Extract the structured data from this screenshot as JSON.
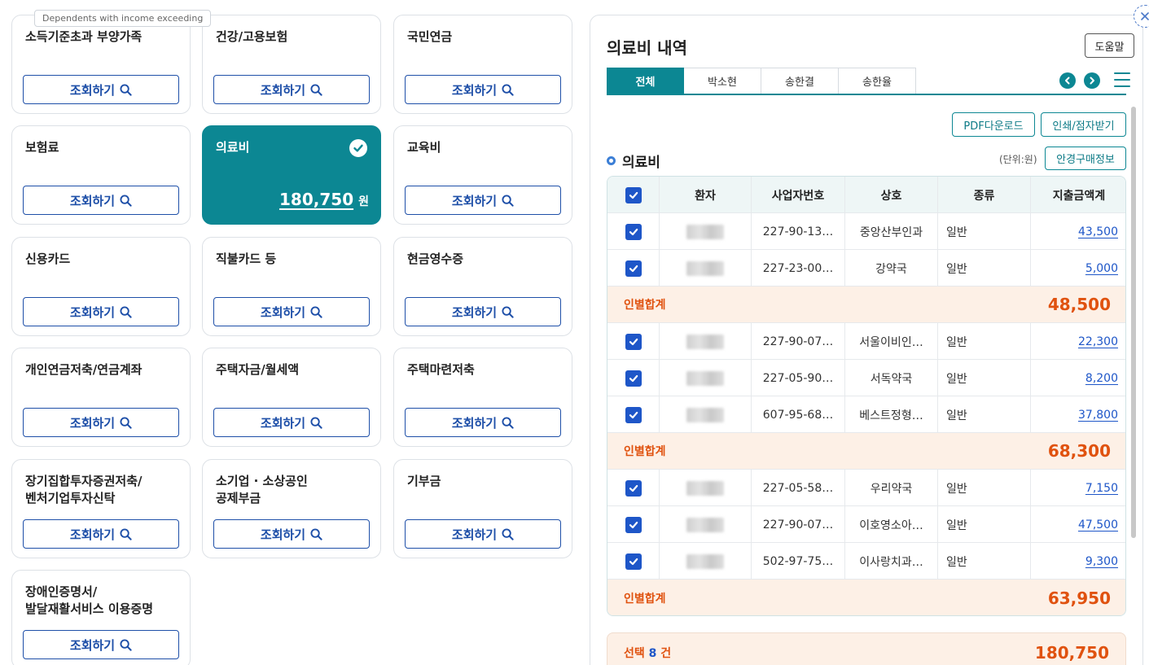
{
  "tooltip": "Dependents with income exceeding",
  "cards": [
    {
      "title": "소득기준초과 부양가족",
      "button": "조회하기"
    },
    {
      "title": "건강/고용보험",
      "button": "조회하기"
    },
    {
      "title": "국민연금",
      "button": "조회하기"
    },
    {
      "title": "보험료",
      "button": "조회하기"
    },
    {
      "title": "의료비",
      "amount": "180,750",
      "unit": "원"
    },
    {
      "title": "교육비",
      "button": "조회하기"
    },
    {
      "title": "신용카드",
      "button": "조회하기"
    },
    {
      "title": "직불카드 등",
      "button": "조회하기"
    },
    {
      "title": "현금영수증",
      "button": "조회하기"
    },
    {
      "title": "개인연금저축/연금계좌",
      "button": "조회하기"
    },
    {
      "title": "주택자금/월세액",
      "button": "조회하기"
    },
    {
      "title": "주택마련저축",
      "button": "조회하기"
    },
    {
      "title_line1": "장기집합투자증권저축/",
      "title_line2": "벤처기업투자신탁",
      "button": "조회하기"
    },
    {
      "title_line1": "소기업 · 소상공인",
      "title_line2": "공제부금",
      "button": "조회하기"
    },
    {
      "title": "기부금",
      "button": "조회하기"
    },
    {
      "title_line1": "장애인증명서/",
      "title_line2": "발달재활서비스 이용증명",
      "button": "조회하기"
    }
  ],
  "panel": {
    "title": "의료비 내역",
    "help": "도움말",
    "tabs": [
      "전체",
      "박소현",
      "송한결",
      "송한율"
    ],
    "pdf_download": "PDF다운로드",
    "print_braille": "인쇄/점자받기",
    "section_title": "의료비",
    "unit": "(단위:원)",
    "glasses_info": "안경구매정보",
    "columns": [
      "환자",
      "사업자번호",
      "상호",
      "종류",
      "지출금액계"
    ],
    "rows": [
      {
        "biz": "227-90-13…",
        "name": "중앙산부인과",
        "kind": "일반",
        "amount": "43,500"
      },
      {
        "biz": "227-23-00…",
        "name": "강약국",
        "kind": "일반",
        "amount": "5,000"
      },
      {
        "biz": "227-90-07…",
        "name": "서울이비인…",
        "kind": "일반",
        "amount": "22,300"
      },
      {
        "biz": "227-05-90…",
        "name": "서독약국",
        "kind": "일반",
        "amount": "8,200"
      },
      {
        "biz": "607-95-68…",
        "name": "베스트정형…",
        "kind": "일반",
        "amount": "37,800"
      },
      {
        "biz": "227-05-58…",
        "name": "우리약국",
        "kind": "일반",
        "amount": "7,150"
      },
      {
        "biz": "227-90-07…",
        "name": "이호영소아…",
        "kind": "일반",
        "amount": "47,500"
      },
      {
        "biz": "502-97-75…",
        "name": "이사랑치과…",
        "kind": "일반",
        "amount": "9,300"
      }
    ],
    "subtotal_label": "인별합계",
    "subtotals": [
      "48,500",
      "68,300",
      "63,950"
    ],
    "total_prefix": "선택",
    "total_count": "8",
    "total_suffix": "건",
    "total_amount": "180,750"
  },
  "colors": {
    "teal": "#0c8793",
    "blue": "#1e56c8",
    "orange": "#e0520f",
    "peach": "#fdf0e6"
  }
}
